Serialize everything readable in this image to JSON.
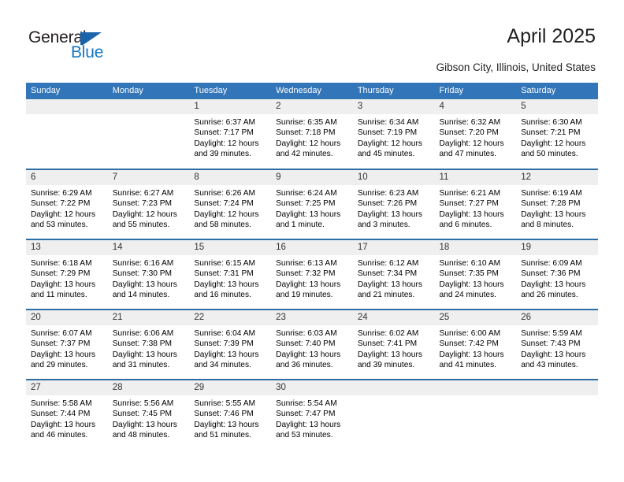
{
  "brand": {
    "name_part1": "General",
    "name_part2": "Blue",
    "accent_color": "#1477c5",
    "triangle_color": "#1b63ab"
  },
  "header": {
    "title": "April 2025",
    "location": "Gibson City, Illinois, United States",
    "header_bg_color": "#3275b8"
  },
  "weekdays": [
    "Sunday",
    "Monday",
    "Tuesday",
    "Wednesday",
    "Thursday",
    "Friday",
    "Saturday"
  ],
  "weeks": [
    [
      {
        "day": "",
        "sunrise": "",
        "sunset": "",
        "daylight1": "",
        "daylight2": "",
        "empty": true
      },
      {
        "day": "",
        "sunrise": "",
        "sunset": "",
        "daylight1": "",
        "daylight2": "",
        "empty": true
      },
      {
        "day": "1",
        "sunrise": "Sunrise: 6:37 AM",
        "sunset": "Sunset: 7:17 PM",
        "daylight1": "Daylight: 12 hours",
        "daylight2": "and 39 minutes."
      },
      {
        "day": "2",
        "sunrise": "Sunrise: 6:35 AM",
        "sunset": "Sunset: 7:18 PM",
        "daylight1": "Daylight: 12 hours",
        "daylight2": "and 42 minutes."
      },
      {
        "day": "3",
        "sunrise": "Sunrise: 6:34 AM",
        "sunset": "Sunset: 7:19 PM",
        "daylight1": "Daylight: 12 hours",
        "daylight2": "and 45 minutes."
      },
      {
        "day": "4",
        "sunrise": "Sunrise: 6:32 AM",
        "sunset": "Sunset: 7:20 PM",
        "daylight1": "Daylight: 12 hours",
        "daylight2": "and 47 minutes."
      },
      {
        "day": "5",
        "sunrise": "Sunrise: 6:30 AM",
        "sunset": "Sunset: 7:21 PM",
        "daylight1": "Daylight: 12 hours",
        "daylight2": "and 50 minutes."
      }
    ],
    [
      {
        "day": "6",
        "sunrise": "Sunrise: 6:29 AM",
        "sunset": "Sunset: 7:22 PM",
        "daylight1": "Daylight: 12 hours",
        "daylight2": "and 53 minutes."
      },
      {
        "day": "7",
        "sunrise": "Sunrise: 6:27 AM",
        "sunset": "Sunset: 7:23 PM",
        "daylight1": "Daylight: 12 hours",
        "daylight2": "and 55 minutes."
      },
      {
        "day": "8",
        "sunrise": "Sunrise: 6:26 AM",
        "sunset": "Sunset: 7:24 PM",
        "daylight1": "Daylight: 12 hours",
        "daylight2": "and 58 minutes."
      },
      {
        "day": "9",
        "sunrise": "Sunrise: 6:24 AM",
        "sunset": "Sunset: 7:25 PM",
        "daylight1": "Daylight: 13 hours",
        "daylight2": "and 1 minute."
      },
      {
        "day": "10",
        "sunrise": "Sunrise: 6:23 AM",
        "sunset": "Sunset: 7:26 PM",
        "daylight1": "Daylight: 13 hours",
        "daylight2": "and 3 minutes."
      },
      {
        "day": "11",
        "sunrise": "Sunrise: 6:21 AM",
        "sunset": "Sunset: 7:27 PM",
        "daylight1": "Daylight: 13 hours",
        "daylight2": "and 6 minutes."
      },
      {
        "day": "12",
        "sunrise": "Sunrise: 6:19 AM",
        "sunset": "Sunset: 7:28 PM",
        "daylight1": "Daylight: 13 hours",
        "daylight2": "and 8 minutes."
      }
    ],
    [
      {
        "day": "13",
        "sunrise": "Sunrise: 6:18 AM",
        "sunset": "Sunset: 7:29 PM",
        "daylight1": "Daylight: 13 hours",
        "daylight2": "and 11 minutes."
      },
      {
        "day": "14",
        "sunrise": "Sunrise: 6:16 AM",
        "sunset": "Sunset: 7:30 PM",
        "daylight1": "Daylight: 13 hours",
        "daylight2": "and 14 minutes."
      },
      {
        "day": "15",
        "sunrise": "Sunrise: 6:15 AM",
        "sunset": "Sunset: 7:31 PM",
        "daylight1": "Daylight: 13 hours",
        "daylight2": "and 16 minutes."
      },
      {
        "day": "16",
        "sunrise": "Sunrise: 6:13 AM",
        "sunset": "Sunset: 7:32 PM",
        "daylight1": "Daylight: 13 hours",
        "daylight2": "and 19 minutes."
      },
      {
        "day": "17",
        "sunrise": "Sunrise: 6:12 AM",
        "sunset": "Sunset: 7:34 PM",
        "daylight1": "Daylight: 13 hours",
        "daylight2": "and 21 minutes."
      },
      {
        "day": "18",
        "sunrise": "Sunrise: 6:10 AM",
        "sunset": "Sunset: 7:35 PM",
        "daylight1": "Daylight: 13 hours",
        "daylight2": "and 24 minutes."
      },
      {
        "day": "19",
        "sunrise": "Sunrise: 6:09 AM",
        "sunset": "Sunset: 7:36 PM",
        "daylight1": "Daylight: 13 hours",
        "daylight2": "and 26 minutes."
      }
    ],
    [
      {
        "day": "20",
        "sunrise": "Sunrise: 6:07 AM",
        "sunset": "Sunset: 7:37 PM",
        "daylight1": "Daylight: 13 hours",
        "daylight2": "and 29 minutes."
      },
      {
        "day": "21",
        "sunrise": "Sunrise: 6:06 AM",
        "sunset": "Sunset: 7:38 PM",
        "daylight1": "Daylight: 13 hours",
        "daylight2": "and 31 minutes."
      },
      {
        "day": "22",
        "sunrise": "Sunrise: 6:04 AM",
        "sunset": "Sunset: 7:39 PM",
        "daylight1": "Daylight: 13 hours",
        "daylight2": "and 34 minutes."
      },
      {
        "day": "23",
        "sunrise": "Sunrise: 6:03 AM",
        "sunset": "Sunset: 7:40 PM",
        "daylight1": "Daylight: 13 hours",
        "daylight2": "and 36 minutes."
      },
      {
        "day": "24",
        "sunrise": "Sunrise: 6:02 AM",
        "sunset": "Sunset: 7:41 PM",
        "daylight1": "Daylight: 13 hours",
        "daylight2": "and 39 minutes."
      },
      {
        "day": "25",
        "sunrise": "Sunrise: 6:00 AM",
        "sunset": "Sunset: 7:42 PM",
        "daylight1": "Daylight: 13 hours",
        "daylight2": "and 41 minutes."
      },
      {
        "day": "26",
        "sunrise": "Sunrise: 5:59 AM",
        "sunset": "Sunset: 7:43 PM",
        "daylight1": "Daylight: 13 hours",
        "daylight2": "and 43 minutes."
      }
    ],
    [
      {
        "day": "27",
        "sunrise": "Sunrise: 5:58 AM",
        "sunset": "Sunset: 7:44 PM",
        "daylight1": "Daylight: 13 hours",
        "daylight2": "and 46 minutes."
      },
      {
        "day": "28",
        "sunrise": "Sunrise: 5:56 AM",
        "sunset": "Sunset: 7:45 PM",
        "daylight1": "Daylight: 13 hours",
        "daylight2": "and 48 minutes."
      },
      {
        "day": "29",
        "sunrise": "Sunrise: 5:55 AM",
        "sunset": "Sunset: 7:46 PM",
        "daylight1": "Daylight: 13 hours",
        "daylight2": "and 51 minutes."
      },
      {
        "day": "30",
        "sunrise": "Sunrise: 5:54 AM",
        "sunset": "Sunset: 7:47 PM",
        "daylight1": "Daylight: 13 hours",
        "daylight2": "and 53 minutes."
      },
      {
        "day": "",
        "sunrise": "",
        "sunset": "",
        "daylight1": "",
        "daylight2": "",
        "empty": true
      },
      {
        "day": "",
        "sunrise": "",
        "sunset": "",
        "daylight1": "",
        "daylight2": "",
        "empty": true
      },
      {
        "day": "",
        "sunrise": "",
        "sunset": "",
        "daylight1": "",
        "daylight2": "",
        "empty": true
      }
    ]
  ]
}
